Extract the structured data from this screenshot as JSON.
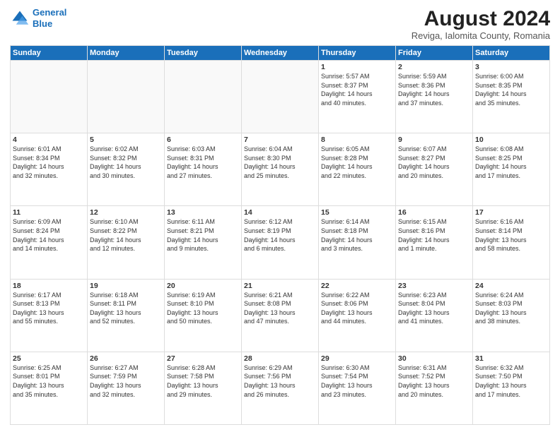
{
  "header": {
    "logo_line1": "General",
    "logo_line2": "Blue",
    "month_title": "August 2024",
    "subtitle": "Reviga, Ialomita County, Romania"
  },
  "weekdays": [
    "Sunday",
    "Monday",
    "Tuesday",
    "Wednesday",
    "Thursday",
    "Friday",
    "Saturday"
  ],
  "weeks": [
    [
      {
        "day": "",
        "info": ""
      },
      {
        "day": "",
        "info": ""
      },
      {
        "day": "",
        "info": ""
      },
      {
        "day": "",
        "info": ""
      },
      {
        "day": "1",
        "info": "Sunrise: 5:57 AM\nSunset: 8:37 PM\nDaylight: 14 hours\nand 40 minutes."
      },
      {
        "day": "2",
        "info": "Sunrise: 5:59 AM\nSunset: 8:36 PM\nDaylight: 14 hours\nand 37 minutes."
      },
      {
        "day": "3",
        "info": "Sunrise: 6:00 AM\nSunset: 8:35 PM\nDaylight: 14 hours\nand 35 minutes."
      }
    ],
    [
      {
        "day": "4",
        "info": "Sunrise: 6:01 AM\nSunset: 8:34 PM\nDaylight: 14 hours\nand 32 minutes."
      },
      {
        "day": "5",
        "info": "Sunrise: 6:02 AM\nSunset: 8:32 PM\nDaylight: 14 hours\nand 30 minutes."
      },
      {
        "day": "6",
        "info": "Sunrise: 6:03 AM\nSunset: 8:31 PM\nDaylight: 14 hours\nand 27 minutes."
      },
      {
        "day": "7",
        "info": "Sunrise: 6:04 AM\nSunset: 8:30 PM\nDaylight: 14 hours\nand 25 minutes."
      },
      {
        "day": "8",
        "info": "Sunrise: 6:05 AM\nSunset: 8:28 PM\nDaylight: 14 hours\nand 22 minutes."
      },
      {
        "day": "9",
        "info": "Sunrise: 6:07 AM\nSunset: 8:27 PM\nDaylight: 14 hours\nand 20 minutes."
      },
      {
        "day": "10",
        "info": "Sunrise: 6:08 AM\nSunset: 8:25 PM\nDaylight: 14 hours\nand 17 minutes."
      }
    ],
    [
      {
        "day": "11",
        "info": "Sunrise: 6:09 AM\nSunset: 8:24 PM\nDaylight: 14 hours\nand 14 minutes."
      },
      {
        "day": "12",
        "info": "Sunrise: 6:10 AM\nSunset: 8:22 PM\nDaylight: 14 hours\nand 12 minutes."
      },
      {
        "day": "13",
        "info": "Sunrise: 6:11 AM\nSunset: 8:21 PM\nDaylight: 14 hours\nand 9 minutes."
      },
      {
        "day": "14",
        "info": "Sunrise: 6:12 AM\nSunset: 8:19 PM\nDaylight: 14 hours\nand 6 minutes."
      },
      {
        "day": "15",
        "info": "Sunrise: 6:14 AM\nSunset: 8:18 PM\nDaylight: 14 hours\nand 3 minutes."
      },
      {
        "day": "16",
        "info": "Sunrise: 6:15 AM\nSunset: 8:16 PM\nDaylight: 14 hours\nand 1 minute."
      },
      {
        "day": "17",
        "info": "Sunrise: 6:16 AM\nSunset: 8:14 PM\nDaylight: 13 hours\nand 58 minutes."
      }
    ],
    [
      {
        "day": "18",
        "info": "Sunrise: 6:17 AM\nSunset: 8:13 PM\nDaylight: 13 hours\nand 55 minutes."
      },
      {
        "day": "19",
        "info": "Sunrise: 6:18 AM\nSunset: 8:11 PM\nDaylight: 13 hours\nand 52 minutes."
      },
      {
        "day": "20",
        "info": "Sunrise: 6:19 AM\nSunset: 8:10 PM\nDaylight: 13 hours\nand 50 minutes."
      },
      {
        "day": "21",
        "info": "Sunrise: 6:21 AM\nSunset: 8:08 PM\nDaylight: 13 hours\nand 47 minutes."
      },
      {
        "day": "22",
        "info": "Sunrise: 6:22 AM\nSunset: 8:06 PM\nDaylight: 13 hours\nand 44 minutes."
      },
      {
        "day": "23",
        "info": "Sunrise: 6:23 AM\nSunset: 8:04 PM\nDaylight: 13 hours\nand 41 minutes."
      },
      {
        "day": "24",
        "info": "Sunrise: 6:24 AM\nSunset: 8:03 PM\nDaylight: 13 hours\nand 38 minutes."
      }
    ],
    [
      {
        "day": "25",
        "info": "Sunrise: 6:25 AM\nSunset: 8:01 PM\nDaylight: 13 hours\nand 35 minutes."
      },
      {
        "day": "26",
        "info": "Sunrise: 6:27 AM\nSunset: 7:59 PM\nDaylight: 13 hours\nand 32 minutes."
      },
      {
        "day": "27",
        "info": "Sunrise: 6:28 AM\nSunset: 7:58 PM\nDaylight: 13 hours\nand 29 minutes."
      },
      {
        "day": "28",
        "info": "Sunrise: 6:29 AM\nSunset: 7:56 PM\nDaylight: 13 hours\nand 26 minutes."
      },
      {
        "day": "29",
        "info": "Sunrise: 6:30 AM\nSunset: 7:54 PM\nDaylight: 13 hours\nand 23 minutes."
      },
      {
        "day": "30",
        "info": "Sunrise: 6:31 AM\nSunset: 7:52 PM\nDaylight: 13 hours\nand 20 minutes."
      },
      {
        "day": "31",
        "info": "Sunrise: 6:32 AM\nSunset: 7:50 PM\nDaylight: 13 hours\nand 17 minutes."
      }
    ]
  ]
}
